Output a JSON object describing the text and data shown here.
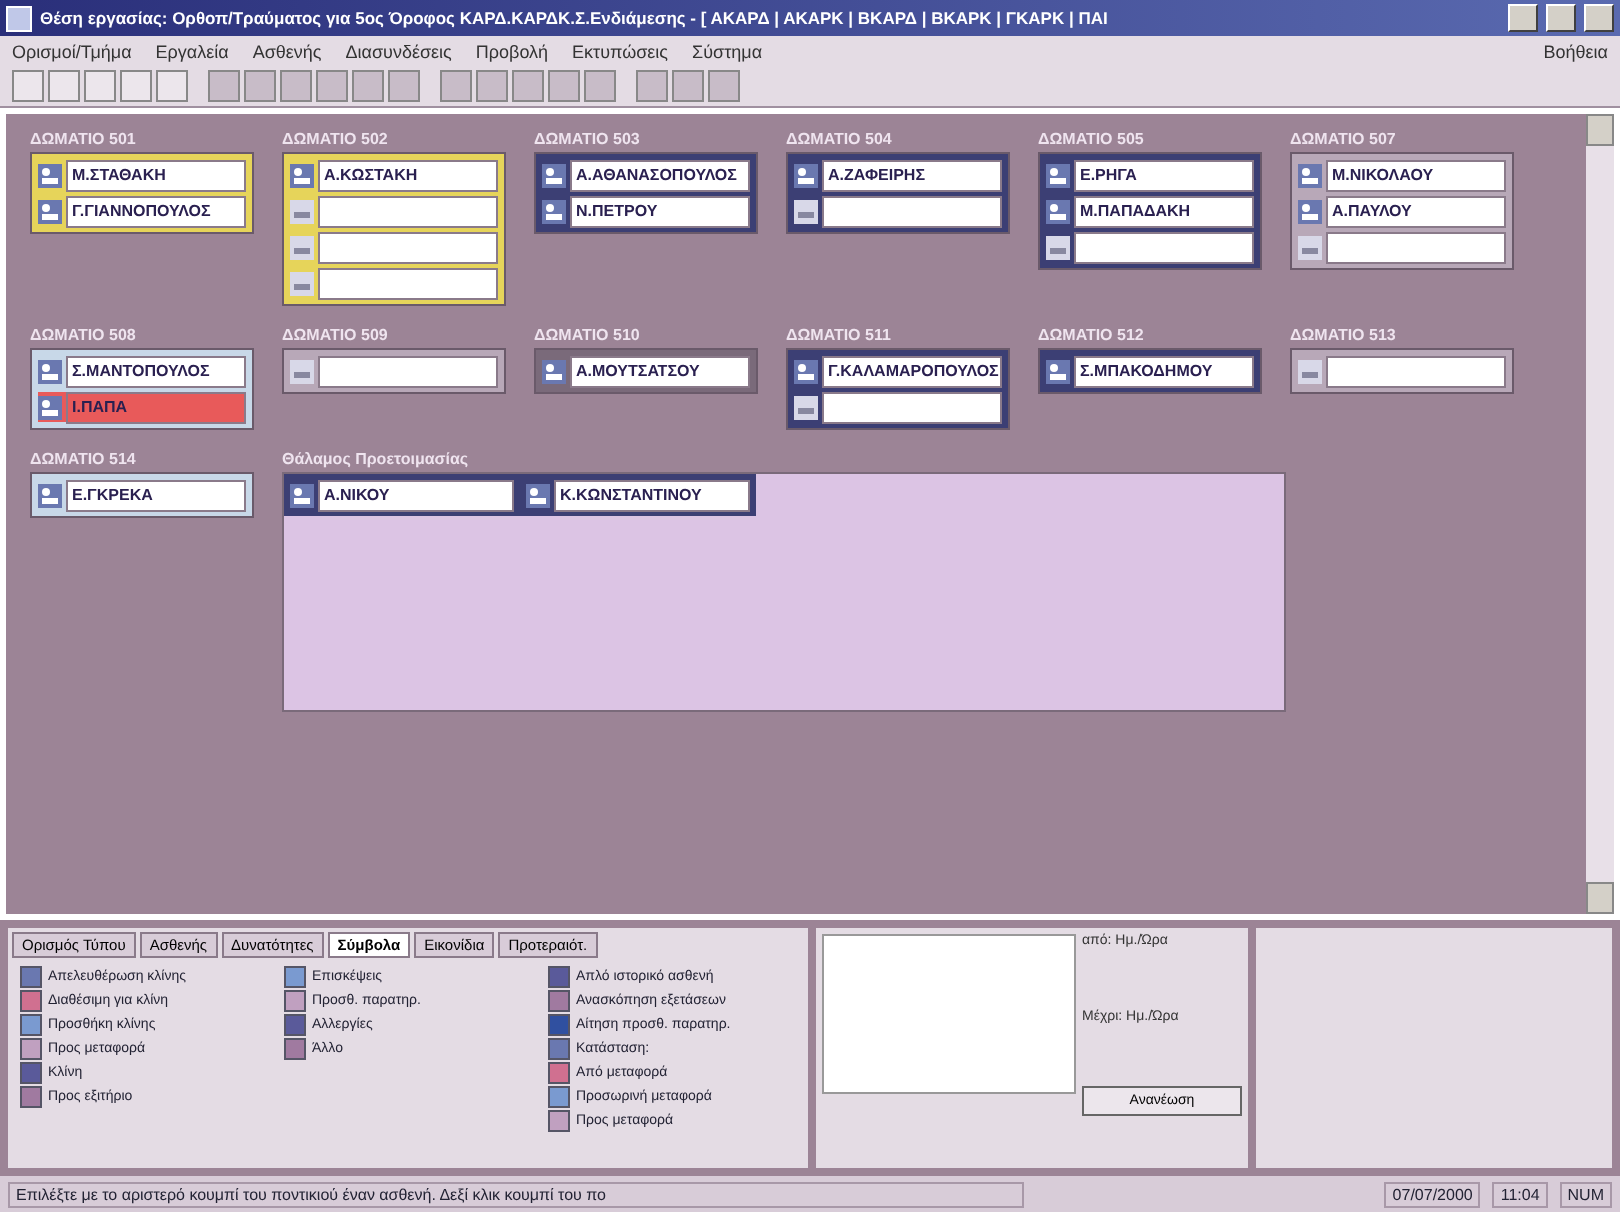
{
  "window": {
    "title": "Θέση εργασίας: Ορθοπ/Τραύματος για 5ος Όροφος ΚΑΡΔ.ΚΑΡΔΚ.Σ.Ενδιάμεσης - [ ΑΚΑΡΔ | ΑΚΑΡΚ | ΒΚΑΡΔ | ΒΚΑΡΚ | ΓΚΑΡΚ | ΠΑΙ"
  },
  "menu": [
    "Ορισμοί/Τμήμα",
    "Εργαλεία",
    "Ασθενής",
    "Διασυνδέσεις",
    "Προβολή",
    "Εκτυπώσεις",
    "Σύστημα"
  ],
  "help_menu": "Βοήθεια",
  "room_rows": [
    [
      {
        "label": "ΔΩΜΑΤΙΟ 501",
        "color": "#e6d45a",
        "beds": [
          {
            "kind": "occupied",
            "name": "Μ.ΣΤΑΘΑΚΗ",
            "alert": false
          },
          {
            "kind": "occupied",
            "name": "Γ.ΓΙΑΝΝΟΠΟΥΛΟΣ",
            "alert": false
          }
        ]
      },
      {
        "label": "ΔΩΜΑΤΙΟ 502",
        "color": "#e6d45a",
        "beds": [
          {
            "kind": "occupied",
            "name": "Α.ΚΩΣΤΑΚΗ",
            "alert": false
          },
          {
            "kind": "empty",
            "alert": false
          },
          {
            "kind": "empty",
            "alert": false
          },
          {
            "kind": "empty",
            "alert": false
          }
        ]
      },
      {
        "label": "ΔΩΜΑΤΙΟ 503",
        "color": "#3c3f74",
        "beds": [
          {
            "kind": "occupied",
            "name": "Α.ΑΘΑΝΑΣΟΠΟΥΛΟΣ",
            "alert": false
          },
          {
            "kind": "occupied",
            "name": "Ν.ΠΕΤΡΟΥ",
            "alert": false
          }
        ]
      },
      {
        "label": "ΔΩΜΑΤΙΟ 504",
        "color": "#3c3f74",
        "beds": [
          {
            "kind": "occupied",
            "name": "Α.ΖΑΦΕΙΡΗΣ",
            "alert": false
          },
          {
            "kind": "empty",
            "alert": false
          }
        ]
      },
      {
        "label": "ΔΩΜΑΤΙΟ 505",
        "color": "#3c3f74",
        "beds": [
          {
            "kind": "occupied",
            "name": "Ε.ΡΗΓΑ",
            "alert": false
          },
          {
            "kind": "occupied",
            "name": "Μ.ΠΑΠΑΔΑΚΗ",
            "alert": false
          },
          {
            "kind": "empty",
            "alert": false
          }
        ]
      },
      {
        "label": "ΔΩΜΑΤΙΟ 507",
        "color": "#b8a8b8",
        "beds": [
          {
            "kind": "occupied",
            "name": "Μ.ΝΙΚΟΛΑΟΥ",
            "alert": false
          },
          {
            "kind": "occupied",
            "name": "Α.ΠΑΥΛΟΥ",
            "alert": false
          },
          {
            "kind": "empty",
            "alert": false
          }
        ]
      }
    ],
    [
      {
        "label": "ΔΩΜΑΤΙΟ 508",
        "color": "#c8d8e8",
        "beds": [
          {
            "kind": "occupied",
            "name": "Σ.ΜΑΝΤΟΠΟΥΛΟΣ",
            "alert": false
          },
          {
            "kind": "occupied",
            "name": "Ι.ΠΑΠΑ",
            "alert": true
          }
        ]
      },
      {
        "label": "ΔΩΜΑΤΙΟ 509",
        "color": "#b8a8b8",
        "beds": [
          {
            "kind": "empty",
            "alert": false
          }
        ]
      },
      {
        "label": "ΔΩΜΑΤΙΟ 510",
        "color": "#7a6a7a",
        "beds": [
          {
            "kind": "occupied",
            "name": "Α.ΜΟΥΤΣΑΤΣΟΥ",
            "alert": false
          }
        ]
      },
      {
        "label": "ΔΩΜΑΤΙΟ 511",
        "color": "#3c3f74",
        "beds": [
          {
            "kind": "occupied",
            "name": "Γ.ΚΑΛΑΜΑΡΟΠΟΥΛΟΣ",
            "alert": false
          },
          {
            "kind": "empty",
            "alert": false
          }
        ]
      },
      {
        "label": "ΔΩΜΑΤΙΟ 512",
        "color": "#3c3f74",
        "beds": [
          {
            "kind": "occupied",
            "name": "Σ.ΜΠΑΚΟΔΗΜΟΥ",
            "alert": false
          }
        ]
      },
      {
        "label": "ΔΩΜΑΤΙΟ 513",
        "color": "#b8a8b8",
        "beds": [
          {
            "kind": "empty",
            "alert": false
          }
        ]
      }
    ],
    [
      {
        "label": "ΔΩΜΑΤΙΟ 514",
        "color": "#c8d8e8",
        "beds": [
          {
            "kind": "occupied",
            "name": "Ε.ΓΚΡΕΚΑ",
            "alert": false
          }
        ]
      }
    ]
  ],
  "preparation": {
    "title": "Θάλαμος Προετοιμασίας",
    "beds": [
      {
        "kind": "occupied",
        "name": "Α.ΝΙΚΟΥ",
        "alert": false
      },
      {
        "kind": "occupied",
        "name": "Κ.ΚΩΝΣΤΑΝΤΙΝΟΥ",
        "alert": false
      }
    ]
  },
  "tabs": [
    {
      "label": "Ορισμός Τύπου",
      "selected": false
    },
    {
      "label": "Ασθενής",
      "selected": false
    },
    {
      "label": "Δυνατότητες",
      "selected": false
    },
    {
      "label": "Σύμβολα",
      "selected": true
    },
    {
      "label": "Εικονίδια",
      "selected": false
    },
    {
      "label": "Προτεραιότ.",
      "selected": false
    }
  ],
  "legend_columns": [
    [
      "Απελευθέρωση κλίνης",
      "Διαθέσιμη για κλίνη",
      "Προσθήκη κλίνης",
      "Προς μεταφορά",
      "Κλίνη",
      "Προς εξιτήριο"
    ],
    [
      "Επισκέψεις",
      "Προσθ. παρατηρ.",
      "Αλλεργίες",
      "Άλλο"
    ],
    [
      "Απλό ιστορικό ασθενή",
      "Ανασκόπηση εξετάσεων",
      "Αίτηση προσθ. παρατηρ.",
      "Κατάσταση:",
      "Από μεταφορά",
      "Προσωρινή μεταφορά",
      "Προς μεταφορά"
    ]
  ],
  "period": {
    "from": "από: Ημ./Ώρα",
    "to": "Μέχρι: Ημ./Ώρα",
    "button": "Ανανέωση"
  },
  "status_bar": {
    "message": "Επιλέξτε με το αριστερό κουμπί του ποντικιού έναν ασθενή. Δεξί κλικ κουμπί του πο",
    "date": "07/07/2000",
    "time": "11:04",
    "keys": "NUM"
  }
}
